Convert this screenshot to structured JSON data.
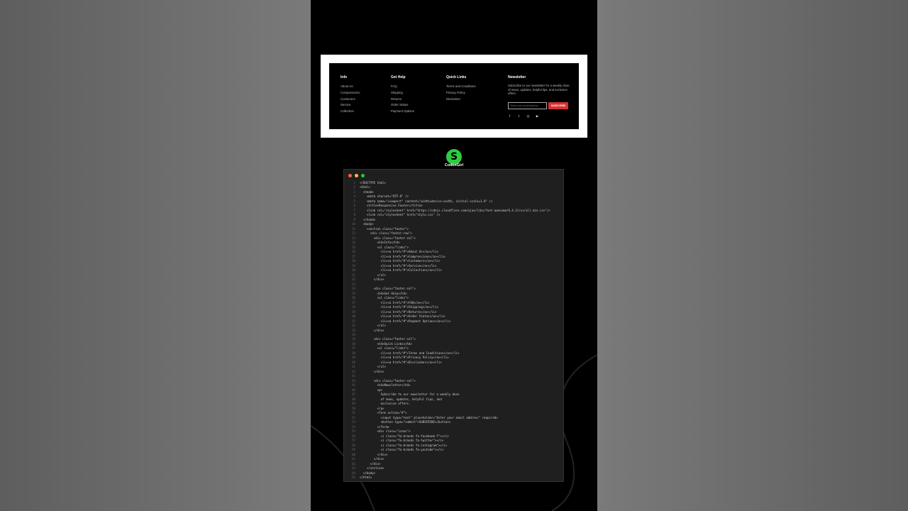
{
  "footer": {
    "columns": [
      {
        "heading": "Info",
        "links": [
          "About Us",
          "Compressions",
          "Customers",
          "Service",
          "Collection"
        ]
      },
      {
        "heading": "Get Help",
        "links": [
          "FAQ",
          "Shipping",
          "Returns",
          "Order Status",
          "Payment Options"
        ]
      },
      {
        "heading": "Quick Links",
        "links": [
          "Terms and Conditions",
          "Privacy Policy",
          "Disclaimer"
        ]
      }
    ],
    "newsletter": {
      "heading": "Newsletter",
      "text": "Subscribe to our newsletter for a weekly dose of news, updates, helpful tips, and exclusive offers.",
      "placeholder": "Enter your email address",
      "button": "SUBSCRIBE",
      "social_icons": [
        "facebook-icon",
        "twitter-icon",
        "instagram-icon",
        "youtube-icon"
      ],
      "social_glyphs": [
        "f",
        "𝕥",
        "◎",
        "▶"
      ]
    }
  },
  "brand": {
    "name": "CodexGirl",
    "accent": "#2ecc40"
  },
  "colors": {
    "subscribe": "#d63031",
    "editor_bg": "#1f1f1f"
  },
  "code_lines": [
    "<!DOCTYPE html>",
    "<html>",
    "  <head>",
    "    <meta charset=\"UTF-8\" />",
    "    <meta name=\"viewport\" content=\"width=device-width, initial-scale=1.0\" />",
    "    <title>Responsive Footer</title>",
    "    <link rel=\"stylesheet\" href=\"https://cdnjs.cloudflare.com/ajax/libs/font-awesome/6.4.2/css/all.min.css\"/>",
    "    <link rel=\"stylesheet\" href=\"style.css\" />",
    "  </head>",
    "  <body>",
    "    <section class=\"footer\">",
    "      <div class=\"footer-row\">",
    "        <div class=\"footer-col\">",
    "          <h4>Info</h4>",
    "          <ul class=\"links\">",
    "            <li><a href=\"#\">About Us</a></li>",
    "            <li><a href=\"#\">Compressions</a></li>",
    "            <li><a href=\"#\">Customers</a></li>",
    "            <li><a href=\"#\">Service</a></li>",
    "            <li><a href=\"#\">Collection</a></li>",
    "          </ul>",
    "        </div>",
    "",
    "        <div class=\"footer-col\">",
    "          <h4>Get Help</h4>",
    "          <ul class=\"links\">",
    "            <li><a href=\"#\">FAQ</a></li>",
    "            <li><a href=\"#\">Shipping</a></li>",
    "            <li><a href=\"#\">Returns</a></li>",
    "            <li><a href=\"#\">Order Status</a></li>",
    "            <li><a href=\"#\">Payment Options</a></li>",
    "          </ul>",
    "        </div>",
    "",
    "        <div class=\"footer-col\">",
    "          <h4>Quick Links</h4>",
    "          <ul class=\"links\">",
    "            <li><a href=\"#\">Terms and Conditions</a></li>",
    "            <li><a href=\"#\">Privacy Policy</a></li>",
    "            <li><a href=\"#\">Disclaimer</a></li>",
    "          </ul>",
    "        </div>",
    "",
    "        <div class=\"footer-col\">",
    "          <h4>Newsletter</h4>",
    "          <p>",
    "            Subscribe to our newsletter for a weekly dose",
    "            of news, updates, helpful tips, and",
    "            exclusive offers.",
    "          </p>",
    "          <form action=\"#\">",
    "            <input type=\"text\" placeholder=\"Enter your email address\" required>",
    "            <button type=\"submit\">SUBSCRIBE</button>",
    "          </form>",
    "          <div class=\"icons\">",
    "            <i class=\"fa-brands fa-facebook-f\"></i>",
    "            <i class=\"fa-brands fa-twitter\"></i>",
    "            <i class=\"fa-brands fa-instagram\"></i>",
    "            <i class=\"fa-brands fa-youtube\"></i>",
    "          </div>",
    "        </div>",
    "      </div>",
    "    </section>",
    "  </body>",
    "</html>"
  ]
}
